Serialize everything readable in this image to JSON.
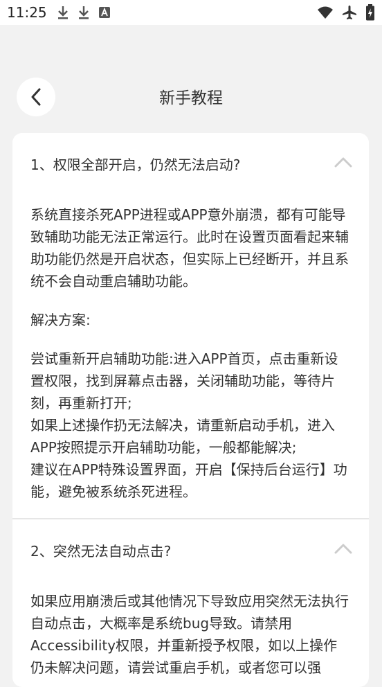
{
  "status_bar": {
    "time": "11:25",
    "left_icons": [
      "download-icon",
      "download-icon",
      "font-a-icon"
    ],
    "right_icons": [
      "wifi-icon",
      "airplane-icon",
      "battery-charging-icon"
    ]
  },
  "header": {
    "title": "新手教程",
    "back_icon": "chevron-left-icon"
  },
  "faqs": [
    {
      "question": "1、权限全部开启，仍然无法启动?",
      "expanded": true,
      "answer": {
        "p1": "系统直接杀死APP进程或APP意外崩溃，都有可能导致辅助功能无法正常运行。此时在设置页面看起来辅助功能仍然是开启状态，但实际上已经断开，并且系统不会自动重启辅助功能。",
        "p2": "解决方案:",
        "p3": "尝试重新开启辅助功能:进入APP首页，点击重新设置权限，找到屏幕点击器，关闭辅助功能，等待片刻，再重新打开;",
        "p4": "如果上述操作扔无法解决，请重新启动手机，进入APP按照提示开启辅助功能，一般都能解决;",
        "p5": "建议在APP特殊设置界面，开启【保持后台运行】功能，避免被系统杀死进程。"
      }
    },
    {
      "question": "2、突然无法自动点击?",
      "expanded": true,
      "answer": {
        "p1": "如果应用崩溃后或其他情况下导致应用突然无法执行自动点击，大概率是系统bug导致。请禁用Accessibility权限，并重新授予权限，如以上操作仍未解决问题，请尝试重启手机，或者您可以强"
      }
    }
  ],
  "colors": {
    "page_bg": "#f2f2f2",
    "card_bg": "#ffffff",
    "text": "#333333",
    "chevron": "#cccccc"
  }
}
